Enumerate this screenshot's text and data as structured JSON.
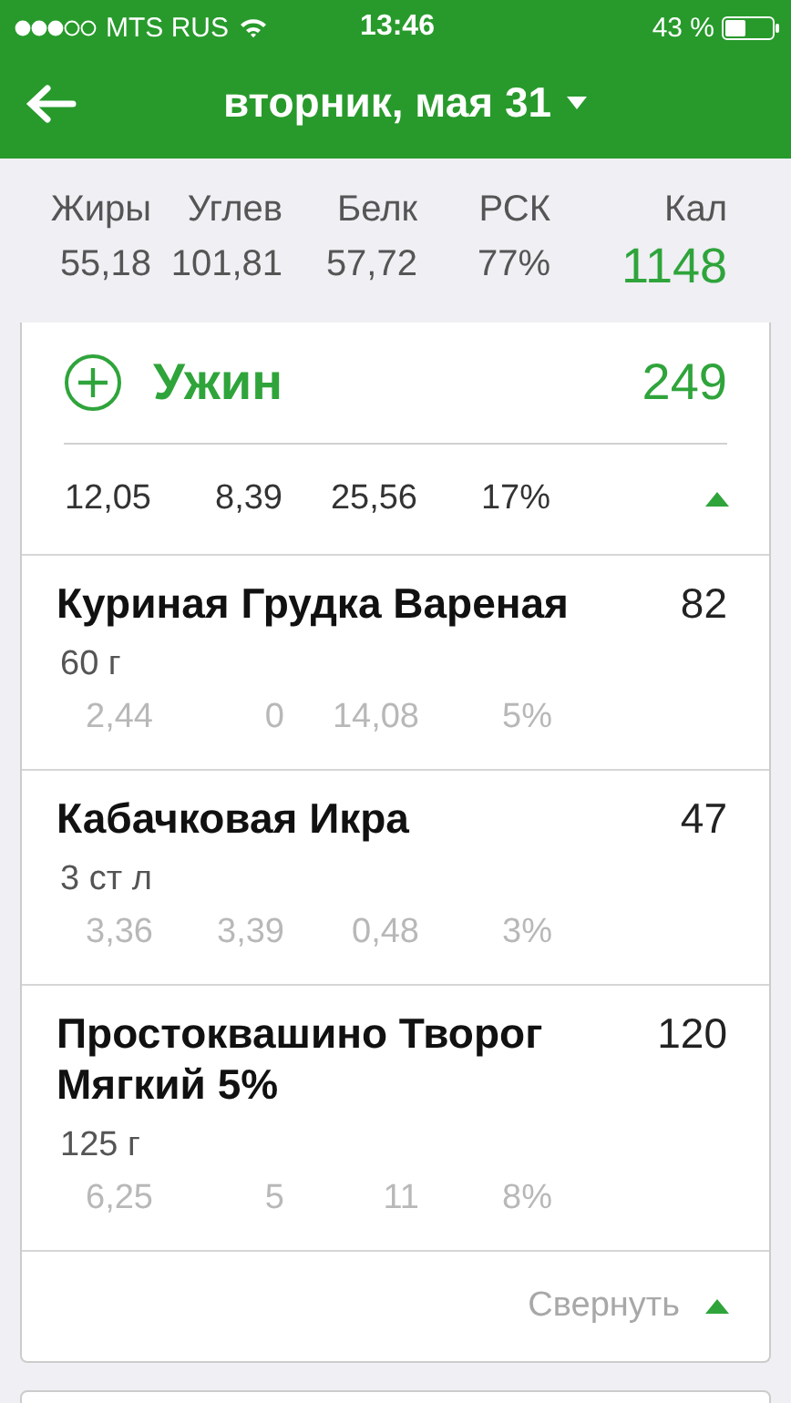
{
  "status_bar": {
    "carrier": "MTS RUS",
    "time": "13:46",
    "battery": "43 %"
  },
  "header": {
    "title": "вторник, мая 31"
  },
  "summary": {
    "columns": [
      {
        "label": "Жиры",
        "value": "55,18"
      },
      {
        "label": "Углев",
        "value": "101,81"
      },
      {
        "label": "Белк",
        "value": "57,72"
      },
      {
        "label": "РСК",
        "value": "77%"
      }
    ],
    "calories": {
      "label": "Кал",
      "value": "1148"
    }
  },
  "meal": {
    "name": "Ужин",
    "calories": "249",
    "totals": [
      "12,05",
      "8,39",
      "25,56",
      "17%"
    ],
    "expanded": true,
    "items": [
      {
        "name": "Куриная Грудка Вареная",
        "calories": "82",
        "portion": "60 г",
        "nutrients": [
          "2,44",
          "0",
          "14,08",
          "5%"
        ]
      },
      {
        "name": "Кабачковая Икра",
        "calories": "47",
        "portion": "3 ст л",
        "nutrients": [
          "3,36",
          "3,39",
          "0,48",
          "3%"
        ]
      },
      {
        "name": "Простоквашино Творог Мягкий 5%",
        "calories": "120",
        "portion": "125 г",
        "nutrients": [
          "6,25",
          "5",
          "11",
          "8%"
        ]
      }
    ],
    "collapse_label": "Свернуть"
  }
}
